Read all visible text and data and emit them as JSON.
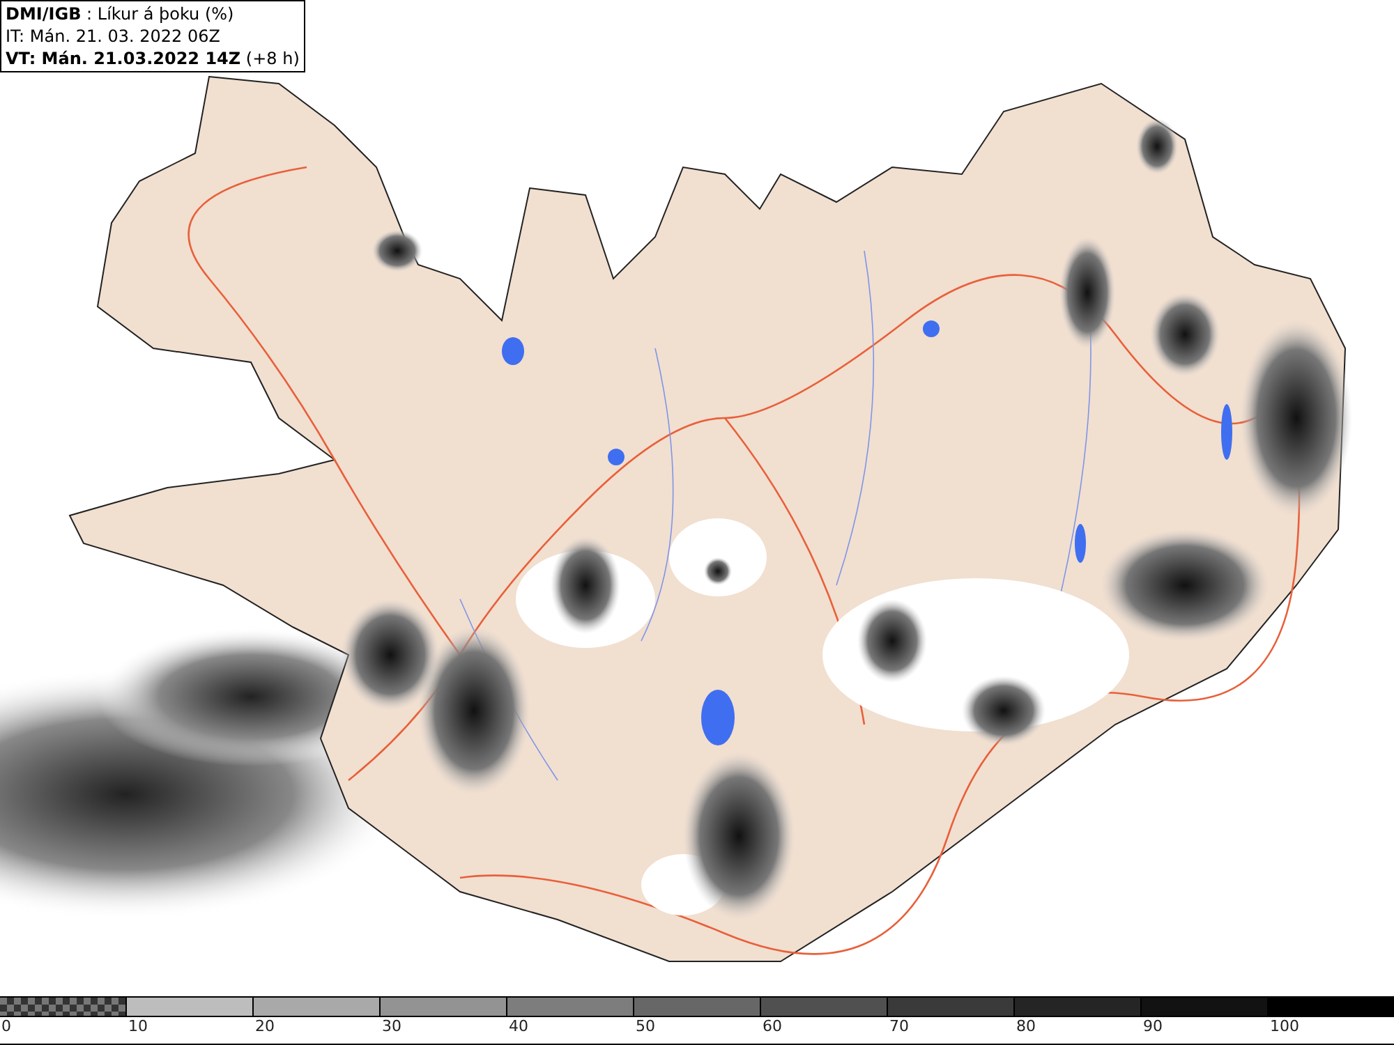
{
  "header": {
    "lines": [
      "**DMI/IGB** : Líkur á þoku (%)",
      "IT: Mán. 21. 03. 2022 06Z",
      "**VT: Mán. 21.03.2022 14Z** (+8 h)"
    ]
  },
  "legend": {
    "segments": [
      {
        "kind": "checker",
        "label": "0"
      },
      {
        "kind": "solid",
        "color": "#bdbdbd",
        "label": "10"
      },
      {
        "kind": "solid",
        "color": "#a9a9a9",
        "label": "20"
      },
      {
        "kind": "solid",
        "color": "#939393",
        "label": "30"
      },
      {
        "kind": "solid",
        "color": "#7d7d7d",
        "label": "40"
      },
      {
        "kind": "solid",
        "color": "#676767",
        "label": "50"
      },
      {
        "kind": "solid",
        "color": "#505050",
        "label": "60"
      },
      {
        "kind": "solid",
        "color": "#3a3a3a",
        "label": "70"
      },
      {
        "kind": "solid",
        "color": "#252525",
        "label": "80"
      },
      {
        "kind": "solid",
        "color": "#121212",
        "label": "90"
      },
      {
        "kind": "solid",
        "color": "#000000",
        "label": "100"
      }
    ]
  }
}
